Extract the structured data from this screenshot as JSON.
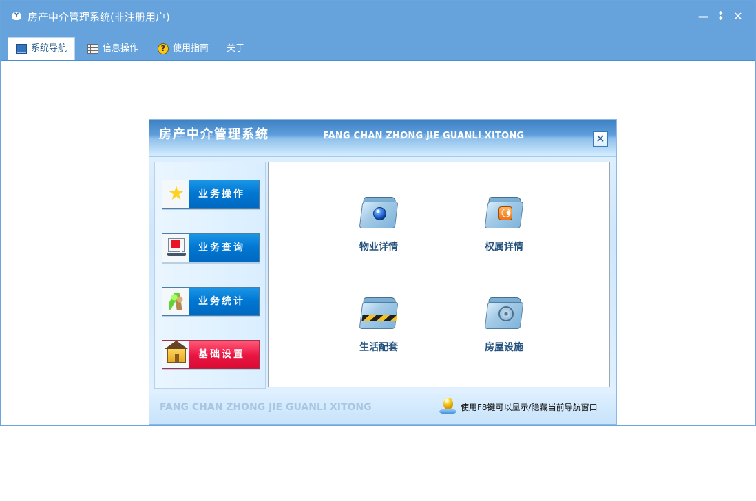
{
  "window": {
    "title": "房产中介管理系统(非注册用户)",
    "app_icon": "app-logo",
    "controls": [
      {
        "name": "minimize",
        "label": "—"
      },
      {
        "name": "restore",
        "label": "⁑"
      },
      {
        "name": "close",
        "label": "✕"
      }
    ]
  },
  "menu": {
    "tabs": [
      {
        "name": "system-navigation",
        "label": "系统导航",
        "icon": "monitor-icon",
        "active": true
      },
      {
        "name": "information-operation",
        "label": "信息操作",
        "icon": "grid-icon",
        "active": false
      },
      {
        "name": "user-guide",
        "label": "使用指南",
        "icon": "help-icon",
        "active": false
      },
      {
        "name": "about",
        "label": "关于",
        "active": false
      }
    ]
  },
  "navigation_panel": {
    "title": "房产中介管理系统",
    "english_title": "FANG CHAN ZHONG JIE GUANLI XITONG",
    "close_label": "✕",
    "side_buttons": [
      {
        "name": "business-operations",
        "label": "业务操作",
        "icon": "star-icon",
        "color": "#0078d2"
      },
      {
        "name": "business-query",
        "label": "业务查询",
        "icon": "monitor-alert-icon",
        "color": "#0078d2"
      },
      {
        "name": "business-statistics",
        "label": "业务统计",
        "icon": "users-icon",
        "color": "#0078d2"
      },
      {
        "name": "basic-settings",
        "label": "基础设置",
        "icon": "house-icon",
        "color": "#e91545"
      }
    ],
    "modules": [
      {
        "name": "property-details",
        "label": "物业详情",
        "icon": "folder-globe-icon"
      },
      {
        "name": "ownership-details",
        "label": "权属详情",
        "icon": "folder-rss-icon"
      },
      {
        "name": "life-services",
        "label": "生活配套",
        "icon": "folder-stripe-icon"
      },
      {
        "name": "house-facilities",
        "label": "房屋设施",
        "icon": "folder-film-icon"
      }
    ],
    "footer": {
      "english_title": "FANG CHAN ZHONG JIE GUANLI XITONG",
      "tip": "使用F8键可以显示/隐藏当前导航窗口",
      "tip_icon": "lightbulb-icon"
    }
  },
  "colors": {
    "window_blue": "#66a3dd",
    "panel_blue": "#dcefff",
    "button_blue": "#0078d2",
    "button_red": "#e91545",
    "module_text": "#25537e"
  }
}
